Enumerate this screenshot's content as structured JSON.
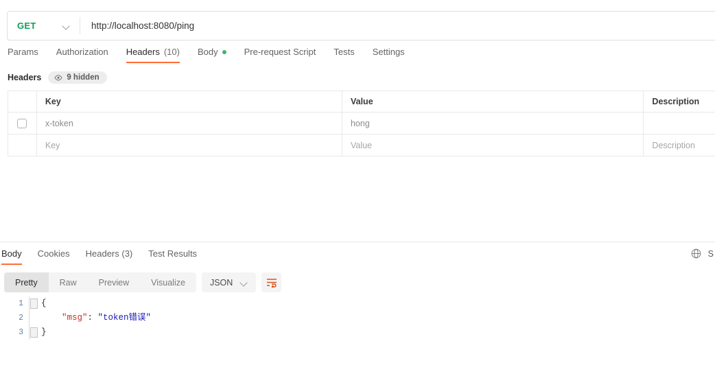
{
  "request": {
    "method": "GET",
    "method_icon": "chevron-down-icon",
    "url": "http://localhost:8080/ping",
    "tabs": [
      {
        "label": "Params",
        "active": false,
        "badge": "",
        "dot": false
      },
      {
        "label": "Authorization",
        "active": false,
        "badge": "",
        "dot": false
      },
      {
        "label": "Headers",
        "active": true,
        "badge": "(10)",
        "dot": false
      },
      {
        "label": "Body",
        "active": false,
        "badge": "",
        "dot": true
      },
      {
        "label": "Pre-request Script",
        "active": false,
        "badge": "",
        "dot": false
      },
      {
        "label": "Tests",
        "active": false,
        "badge": "",
        "dot": false
      },
      {
        "label": "Settings",
        "active": false,
        "badge": "",
        "dot": false
      }
    ]
  },
  "headers_section": {
    "title": "Headers",
    "hidden_pill": "9 hidden",
    "hidden_icon": "eye-icon",
    "columns": [
      "Key",
      "Value",
      "Description"
    ],
    "rows": [
      {
        "checked": false,
        "key": "x-token",
        "value": "hong",
        "description": "",
        "placeholder": false
      },
      {
        "checked": null,
        "key": "Key",
        "value": "Value",
        "description": "Description",
        "placeholder": true
      }
    ]
  },
  "response": {
    "tabs": [
      {
        "label": "Body",
        "active": true
      },
      {
        "label": "Cookies",
        "active": false
      },
      {
        "label": "Headers (3)",
        "active": false
      },
      {
        "label": "Test Results",
        "active": false
      }
    ],
    "globe_icon": "globe-icon",
    "save_label": "S",
    "format_modes": [
      {
        "label": "Pretty",
        "active": true
      },
      {
        "label": "Raw",
        "active": false
      },
      {
        "label": "Preview",
        "active": false
      },
      {
        "label": "Visualize",
        "active": false
      }
    ],
    "language": "JSON",
    "language_icon": "chevron-down-icon",
    "wrap_icon": "word-wrap-icon",
    "body_lines": [
      {
        "no": "1",
        "fold": true,
        "segments": [
          {
            "text": "{",
            "cls": "brace"
          }
        ]
      },
      {
        "no": "2",
        "fold": false,
        "segments": [
          {
            "text": "    ",
            "cls": "punct"
          },
          {
            "text": "\"msg\"",
            "cls": "k-str"
          },
          {
            "text": ": ",
            "cls": "punct"
          },
          {
            "text": "\"token错误\"",
            "cls": "v-str"
          }
        ]
      },
      {
        "no": "3",
        "fold": true,
        "segments": [
          {
            "text": "}",
            "cls": "brace"
          }
        ]
      }
    ]
  },
  "colors": {
    "accent": "#ff6c37",
    "method_get": "#0f9d58",
    "body_dot": "#3cb46e",
    "json_key": "#c0341d",
    "json_value": "#1a1ab5",
    "wrap_icon": "#d9480f"
  }
}
